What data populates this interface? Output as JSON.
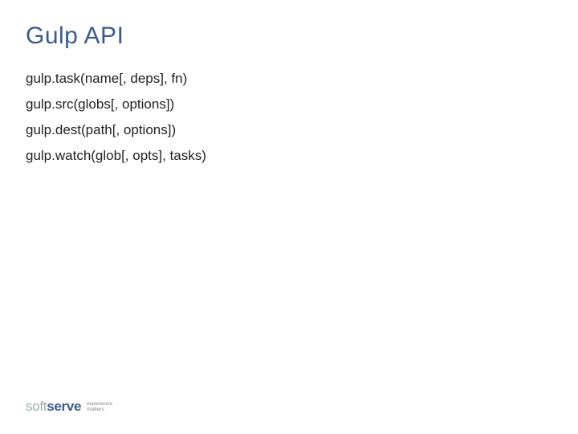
{
  "title": "Gulp API",
  "api": {
    "lines": [
      "gulp.task(name[, deps], fn)",
      "gulp.src(globs[, options])",
      "gulp.dest(path[, options])",
      "gulp.watch(glob[, opts], tasks)"
    ]
  },
  "logo": {
    "soft": "soft",
    "serve": "serve",
    "tagline1": "experience",
    "tagline2": "matters"
  }
}
